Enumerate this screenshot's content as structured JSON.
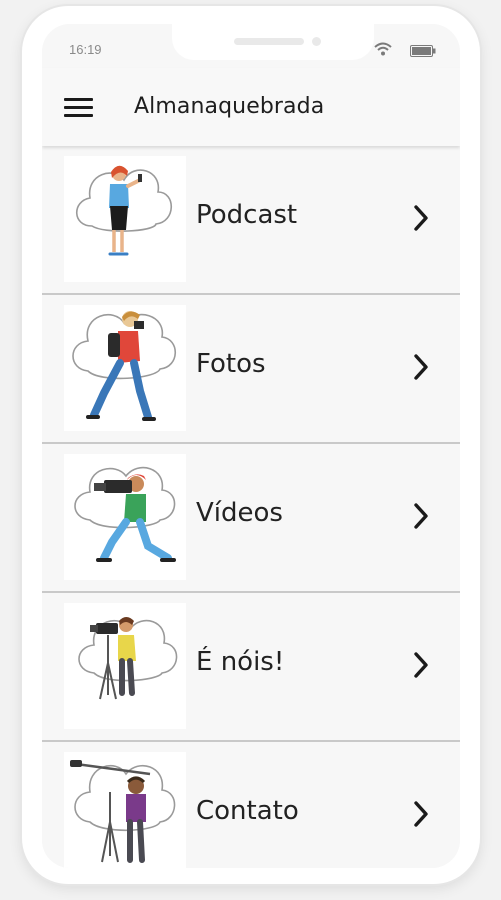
{
  "status_bar": {
    "time": "16:19",
    "icons": [
      "wifi-icon",
      "battery-icon"
    ]
  },
  "app_bar": {
    "title": "Almanaquebrada",
    "menu_icon": "hamburger-menu-icon"
  },
  "menu": {
    "items": [
      {
        "label": "Podcast",
        "illustration": "podcast-illustration",
        "icon": "chevron-right-icon"
      },
      {
        "label": "Fotos",
        "illustration": "photographer-illustration",
        "icon": "chevron-right-icon"
      },
      {
        "label": "Vídeos",
        "illustration": "videomaker-illustration",
        "icon": "chevron-right-icon"
      },
      {
        "label": "É nóis!",
        "illustration": "camera-tripod-illustration",
        "icon": "chevron-right-icon"
      },
      {
        "label": "Contato",
        "illustration": "boom-microphone-illustration",
        "icon": "chevron-right-icon"
      }
    ]
  },
  "colors": {
    "background": "#f7f7f7",
    "text": "#222222",
    "divider": "#c9c9c9"
  }
}
